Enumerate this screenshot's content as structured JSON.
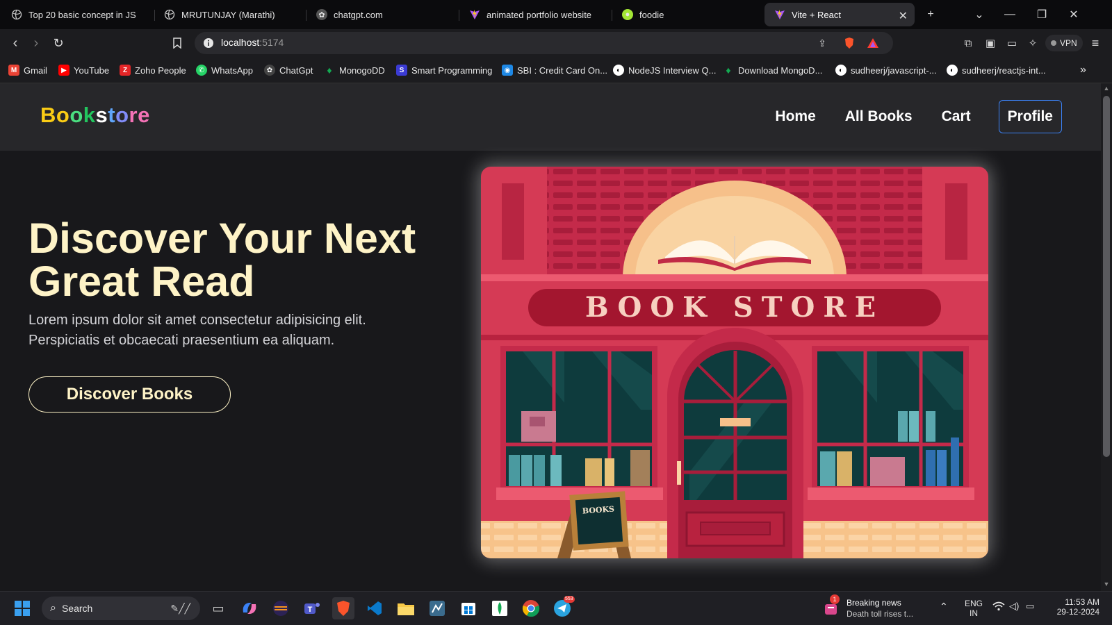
{
  "browser": {
    "tabs": [
      {
        "title": "Top 20 basic concept in JS",
        "icon": "globe-icon"
      },
      {
        "title": "MRUTUNJAY (Marathi)",
        "icon": "globe-icon"
      },
      {
        "title": "chatgpt.com",
        "icon": "chatgpt-icon"
      },
      {
        "title": "animated portfolio website",
        "icon": "vite-icon"
      },
      {
        "title": "foodie",
        "icon": "foodie-icon"
      },
      {
        "title": "Vite + React",
        "icon": "vite-icon",
        "active": true
      }
    ],
    "address": {
      "host": "localhost",
      "port": ":5174"
    },
    "vpn_label": "VPN",
    "bookmarks": [
      {
        "label": "Gmail",
        "icon": "gmail-icon",
        "color": "#ea4335"
      },
      {
        "label": "YouTube",
        "icon": "youtube-icon",
        "color": "#ff0000"
      },
      {
        "label": "Zoho People",
        "icon": "zoho-icon",
        "color": "#e42527"
      },
      {
        "label": "WhatsApp",
        "icon": "whatsapp-icon",
        "color": "#25d366"
      },
      {
        "label": "ChatGpt",
        "icon": "chatgpt-icon",
        "color": "#444444"
      },
      {
        "label": "MonogoDD",
        "icon": "mongodb-icon",
        "color": "#13aa52"
      },
      {
        "label": "Smart Programming",
        "icon": "smart-programming-icon",
        "color": "#3b3bd4"
      },
      {
        "label": "SBI : Credit Card On...",
        "icon": "sbi-icon",
        "color": "#1e88e5"
      },
      {
        "label": "NodeJS Interview Q...",
        "icon": "github-icon",
        "color": "#ffffff"
      },
      {
        "label": "Download MongoD...",
        "icon": "mongodb-icon",
        "color": "#13aa52"
      },
      {
        "label": "sudheerj/javascript-...",
        "icon": "github-icon",
        "color": "#ffffff"
      },
      {
        "label": "sudheerj/reactjs-int...",
        "icon": "github-icon",
        "color": "#ffffff"
      }
    ]
  },
  "site": {
    "logo_letters": [
      {
        "ch": "B",
        "color": "#facc15"
      },
      {
        "ch": "o",
        "color": "#facc15"
      },
      {
        "ch": "o",
        "color": "#4ade80"
      },
      {
        "ch": "k",
        "color": "#22c55e"
      },
      {
        "ch": "s",
        "color": "#ffffff"
      },
      {
        "ch": "t",
        "color": "#60a5fa"
      },
      {
        "ch": "o",
        "color": "#818cf8"
      },
      {
        "ch": "r",
        "color": "#f472b6"
      },
      {
        "ch": "e",
        "color": "#f472b6"
      }
    ],
    "nav": {
      "home": "Home",
      "all_books": "All Books",
      "cart": "Cart",
      "profile": "Profile"
    },
    "hero": {
      "title_line1": "Discover Your Next",
      "title_line2": "Great Read",
      "subtitle": "Lorem ipsum dolor sit amet consectetur adipisicing elit. Perspiciatis et obcaecati praesentium ea aliquam.",
      "cta": "Discover Books"
    },
    "illustration": {
      "sign_text": "BOOK STORE",
      "board_text": "BOOKS"
    },
    "colors": {
      "title": "#fef3c7",
      "page_bg": "#18181b",
      "nav_bg": "#27272a",
      "profile_border": "#3b82f6"
    }
  },
  "taskbar": {
    "search_placeholder": "Search",
    "news_title": "Breaking news",
    "news_sub": "Death toll rises t...",
    "news_badge": "1",
    "telegram_badge": "553",
    "lang_line1": "ENG",
    "lang_line2": "IN",
    "time": "11:53 AM",
    "date": "29-12-2024"
  }
}
